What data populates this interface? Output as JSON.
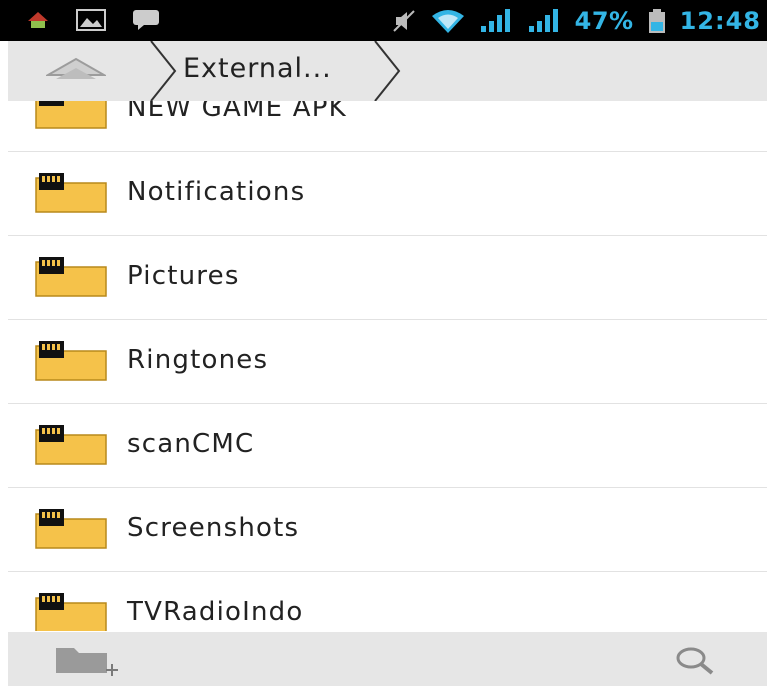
{
  "status_bar": {
    "icons": [
      "app-notification-icon",
      "image-notification-icon",
      "chat-notification-icon",
      "mute-icon",
      "wifi-icon",
      "signal-1-icon",
      "signal-2-icon",
      "battery-icon"
    ],
    "battery_percent": "47%",
    "time": "12:48"
  },
  "nav": {
    "breadcrumb": "External..."
  },
  "folders": [
    {
      "name": "NEW GAME APK"
    },
    {
      "name": "Notifications"
    },
    {
      "name": "Pictures"
    },
    {
      "name": "Ringtones"
    },
    {
      "name": "scanCMC"
    },
    {
      "name": "Screenshots"
    },
    {
      "name": "TVRadioIndo"
    }
  ],
  "bottom_bar": {
    "icons": [
      "new-folder-icon",
      "search-icon"
    ]
  },
  "colors": {
    "accent": "#33b5e5",
    "folder": "#f5c24a",
    "bar": "#e6e6e6"
  }
}
